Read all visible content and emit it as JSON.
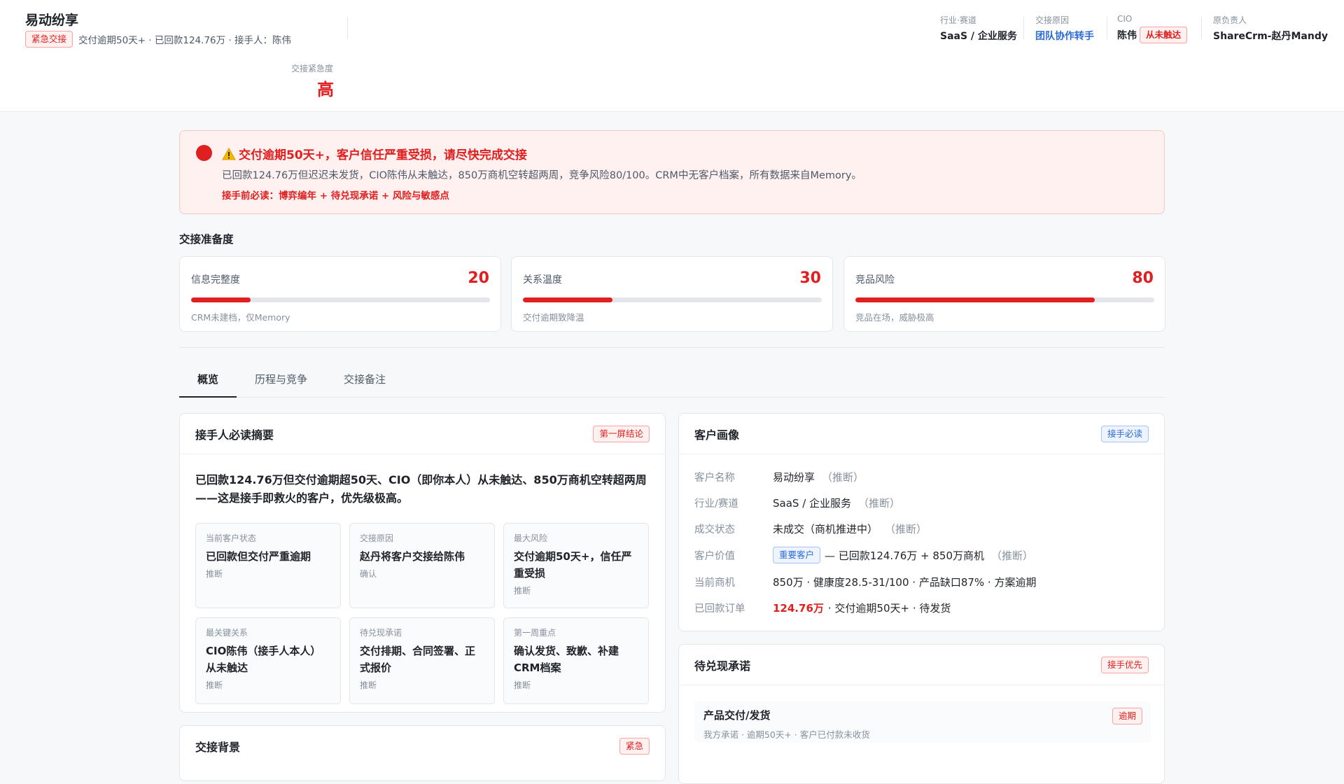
{
  "header": {
    "title": "易动纷享",
    "urgent_tag": "紧急交接",
    "summary": "交付逾期50天+ · 已回款124.76万 · 接手人：陈伟",
    "urgency_label": "交接紧急度",
    "urgency_value": "高",
    "meta": {
      "industry_label": "行业·赛道",
      "industry_value": "SaaS / 企业服务",
      "reason_label": "交接原因",
      "reason_value": "团队协作转手",
      "cio_label": "CIO",
      "cio_value": "陈伟",
      "cio_tag": "从未触达",
      "owner_label": "原负责人",
      "owner_value": "ShareCrm-赵丹Mandy"
    }
  },
  "alert": {
    "title": "交付逾期50天+，客户信任严重受损，请尽快完成交接",
    "desc": "已回款124.76万但迟迟未发货，CIO陈伟从未触达，850万商机空转超两周，竞争风险80/100。CRM中无客户档案，所有数据来自Memory。",
    "must_read": "接手前必读：博弈编年 + 待兑现承诺 + 风险与敏感点"
  },
  "readiness": {
    "title": "交接准备度",
    "metrics": [
      {
        "label": "信息完整度",
        "value": "20",
        "level": 0.2,
        "note": "CRM未建档，仅Memory"
      },
      {
        "label": "关系温度",
        "value": "30",
        "level": 0.3,
        "note": "交付逾期致降温"
      },
      {
        "label": "竞品风险",
        "value": "80",
        "level": 0.8,
        "note": "竞品在场，威胁极高"
      }
    ]
  },
  "tabs": [
    "概览",
    "历程与竞争",
    "交接备注"
  ],
  "summary_card": {
    "title": "接手人必读摘要",
    "tag": "第一屏结论",
    "text": "已回款124.76万但交付逾期超50天、CIO（即你本人）从未触达、850万商机空转超两周——这是接手即救火的客户，优先级极高。",
    "cells": [
      {
        "label": "当前客户状态",
        "value": "已回款但交付严重逾期",
        "note": "推断"
      },
      {
        "label": "交接原因",
        "value": "赵丹将客户交接给陈伟",
        "note": "确认"
      },
      {
        "label": "最大风险",
        "value": "交付逾期50天+，信任严重受损",
        "note": "推断"
      },
      {
        "label": "最关键关系",
        "value": "CIO陈伟（接手人本人）从未触达",
        "note": "推断"
      },
      {
        "label": "待兑现承诺",
        "value": "交付排期、合同签署、正式报价",
        "note": "推断"
      },
      {
        "label": "第一周重点",
        "value": "确认发货、致歉、补建CRM档案",
        "note": "推断"
      }
    ]
  },
  "background_card": {
    "title": "交接背景",
    "tag": "紧急"
  },
  "profile_card": {
    "title": "客户画像",
    "tag": "接手必读",
    "rows": {
      "name": {
        "key": "客户名称",
        "value": "易动纷享",
        "hint": "（推断）"
      },
      "industry": {
        "key": "行业/赛道",
        "value": "SaaS / 企业服务",
        "hint": "（推断）"
      },
      "deal": {
        "key": "成交状态",
        "value": "未成交（商机推进中）",
        "hint": "（推断）"
      },
      "value": {
        "key": "客户价值",
        "tag": "重要客户",
        "value": "— 已回款124.76万 + 850万商机",
        "hint": "（推断）"
      },
      "opportunity": {
        "key": "当前商机",
        "value": "850万 · 健康度28.5-31/100 · 产品缺口87% · 方案逾期"
      },
      "orders": {
        "key": "已回款订单",
        "amount": "124.76万",
        "value": " · 交付逾期50天+ · 待发货"
      }
    }
  },
  "promise_card": {
    "title": "待兑现承诺",
    "tag": "接手优先",
    "item": {
      "title": "产品交付/发货",
      "desc": "我方承诺 · 逾期50天+ · 客户已付款未收货",
      "tag": "逾期"
    }
  },
  "colors": {
    "accent_red": "#e02020",
    "accent_blue": "#2b6bd6",
    "alert_bg": "#fff1f0"
  }
}
